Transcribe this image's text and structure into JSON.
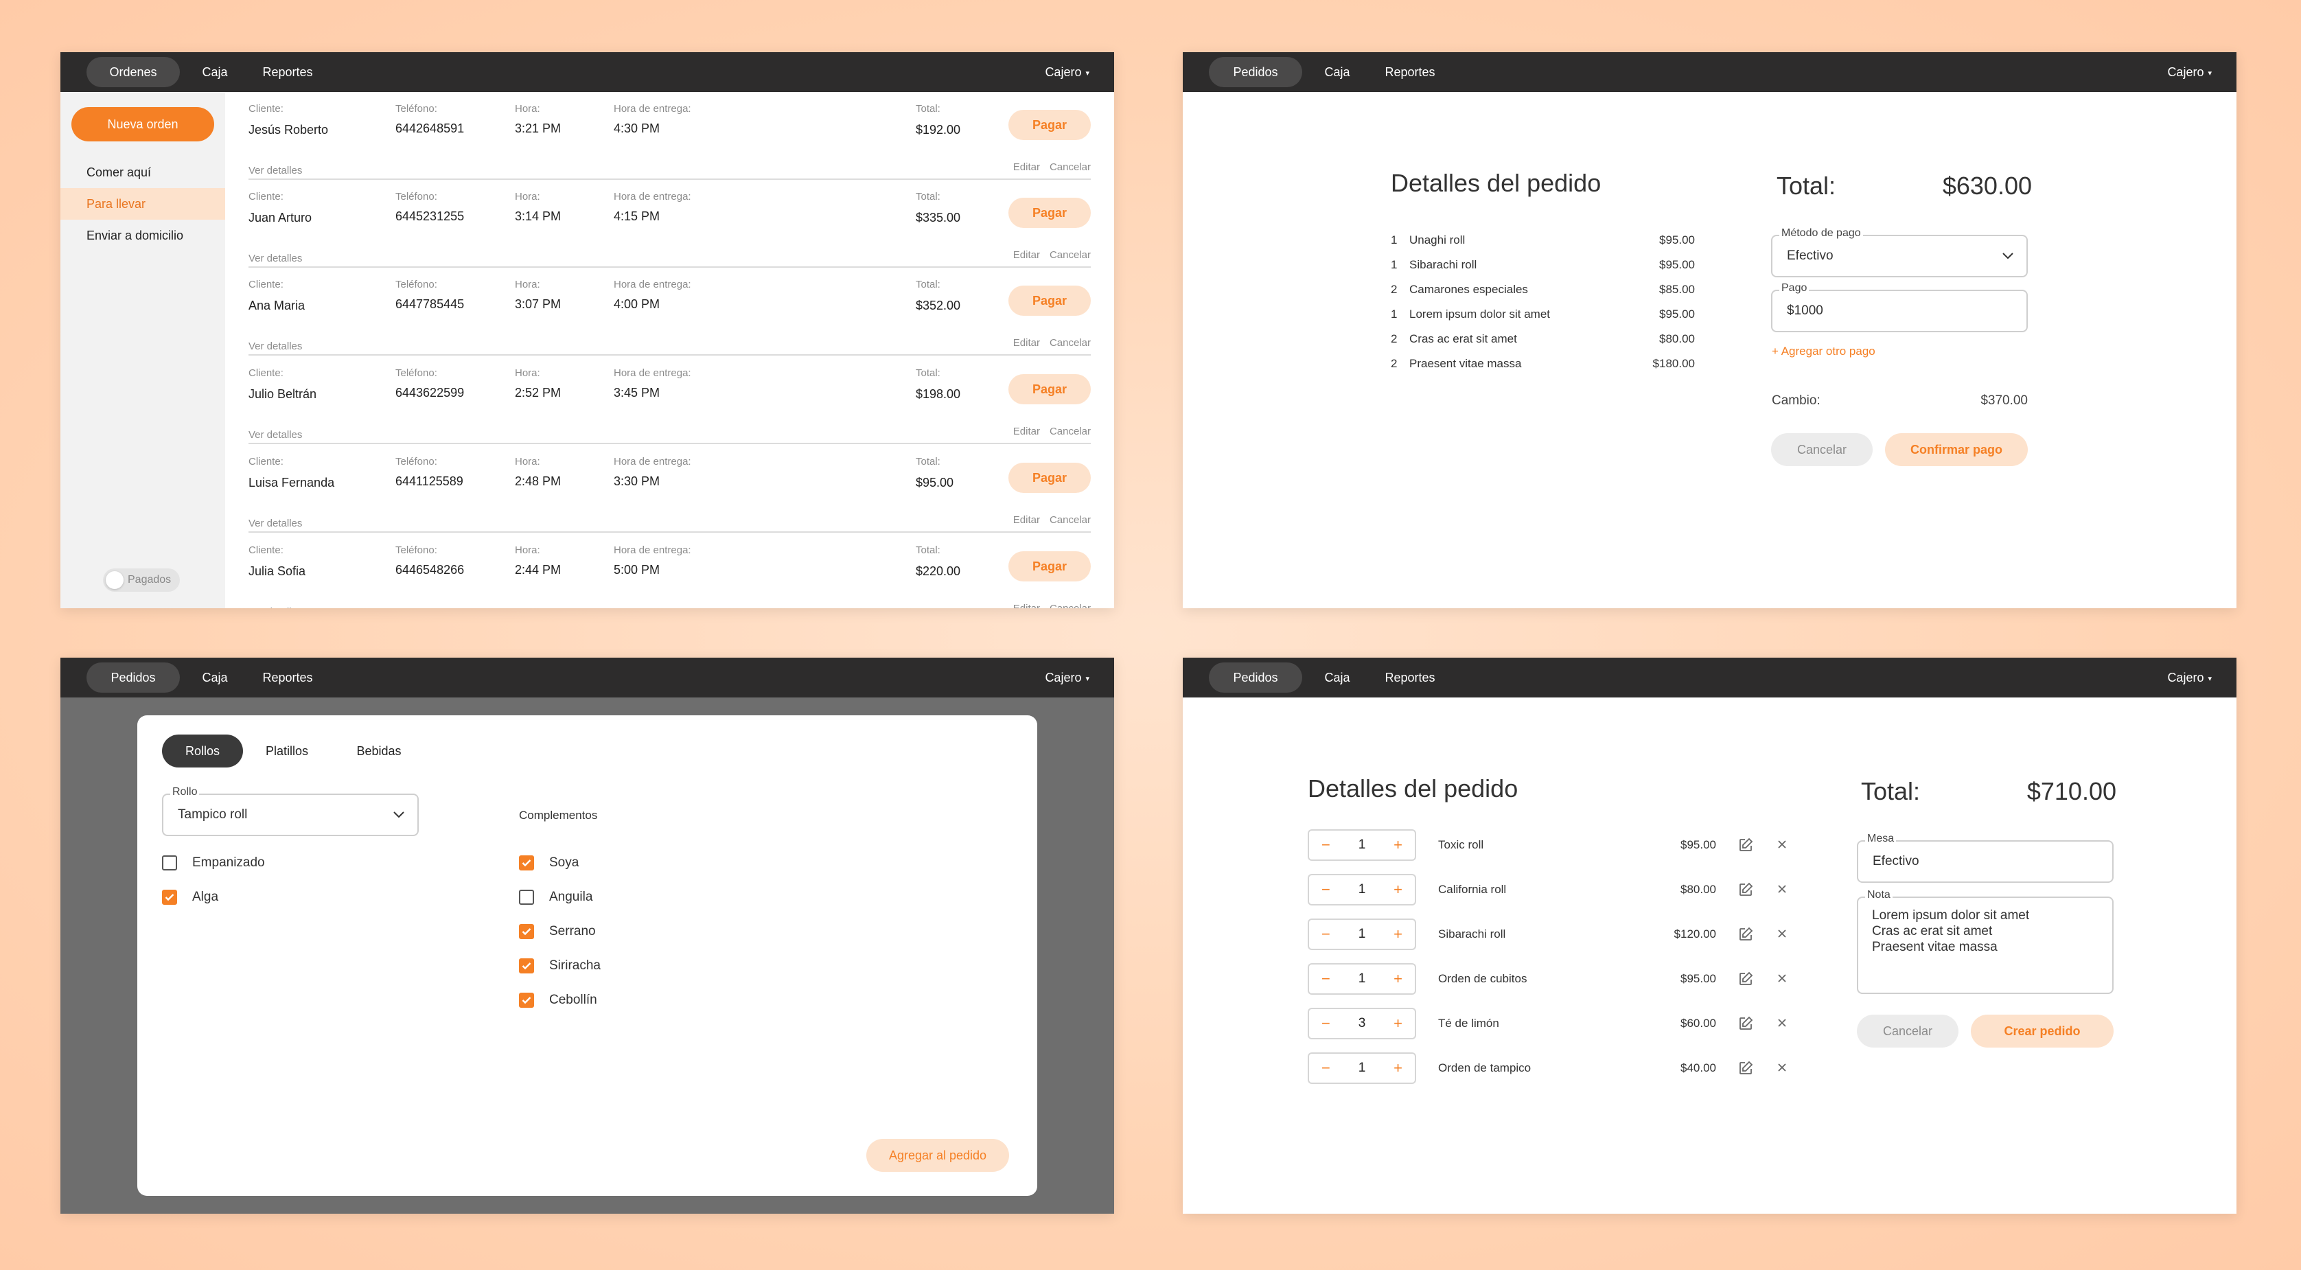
{
  "colors": {
    "accent": "#f58025",
    "accent_soft": "#fde2cc",
    "topbar": "#2d2c2c"
  },
  "panel1": {
    "nav": {
      "tabs": [
        "Ordenes",
        "Caja",
        "Reportes"
      ],
      "user": "Cajero"
    },
    "new_order": "Nueva orden",
    "sidebar": [
      "Comer aquí",
      "Para llevar",
      "Enviar a domicilio"
    ],
    "toggle": "Pagados",
    "labels": {
      "client": "Cliente:",
      "phone": "Teléfono:",
      "time": "Hora:",
      "delivery": "Hora de entrega:",
      "total": "Total:",
      "pay": "Pagar",
      "details": "Ver detalles",
      "edit": "Editar",
      "cancel": "Cancelar"
    },
    "orders": [
      {
        "client": "Jesús Roberto",
        "phone": "6442648591",
        "time": "3:21 PM",
        "delivery": "4:30 PM",
        "total": "$192.00"
      },
      {
        "client": "Juan Arturo",
        "phone": "6445231255",
        "time": "3:14 PM",
        "delivery": "4:15 PM",
        "total": "$335.00"
      },
      {
        "client": "Ana Maria",
        "phone": "6447785445",
        "time": "3:07 PM",
        "delivery": "4:00 PM",
        "total": "$352.00"
      },
      {
        "client": "Julio Beltrán",
        "phone": "6443622599",
        "time": "2:52 PM",
        "delivery": "3:45 PM",
        "total": "$198.00"
      },
      {
        "client": "Luisa Fernanda",
        "phone": "6441125589",
        "time": "2:48 PM",
        "delivery": "3:30 PM",
        "total": "$95.00"
      },
      {
        "client": "Julia Sofia",
        "phone": "6446548266",
        "time": "2:44 PM",
        "delivery": "5:00 PM",
        "total": "$220.00"
      }
    ]
  },
  "panel2": {
    "nav": {
      "tabs": [
        "Pedidos",
        "Caja",
        "Reportes"
      ],
      "user": "Cajero"
    },
    "title": "Detalles del pedido",
    "items": [
      {
        "qty": "1",
        "name": "Unaghi roll",
        "price": "$95.00"
      },
      {
        "qty": "1",
        "name": "Sibarachi roll",
        "price": "$95.00"
      },
      {
        "qty": "2",
        "name": "Camarones especiales",
        "price": "$85.00"
      },
      {
        "qty": "1",
        "name": "Lorem ipsum dolor sit amet",
        "price": "$95.00"
      },
      {
        "qty": "2",
        "name": "Cras ac erat sit amet",
        "price": "$80.00"
      },
      {
        "qty": "2",
        "name": "Praesent vitae massa",
        "price": "$180.00"
      }
    ],
    "total_label": "Total:",
    "total": "$630.00",
    "method_label": "Método de pago",
    "method": "Efectivo",
    "payment_label": "Pago",
    "payment": "$1000",
    "add_payment": "+ Agregar otro pago",
    "change_label": "Cambio:",
    "change": "$370.00",
    "cancel": "Cancelar",
    "confirm": "Confirmar pago"
  },
  "panel3": {
    "nav": {
      "tabs": [
        "Pedidos",
        "Caja",
        "Reportes"
      ],
      "user": "Cajero"
    },
    "categories": [
      "Rollos",
      "Platillos",
      "Bebidas"
    ],
    "roll_label": "Rollo",
    "roll": "Tampico roll",
    "options": [
      {
        "label": "Empanizado",
        "checked": false
      },
      {
        "label": "Alga",
        "checked": true
      }
    ],
    "complements_title": "Complementos",
    "complements": [
      {
        "label": "Soya",
        "checked": true
      },
      {
        "label": "Anguila",
        "checked": false
      },
      {
        "label": "Serrano",
        "checked": true
      },
      {
        "label": "Siriracha",
        "checked": true
      },
      {
        "label": "Cebollín",
        "checked": true
      }
    ],
    "add": "Agregar al pedido"
  },
  "panel4": {
    "nav": {
      "tabs": [
        "Pedidos",
        "Caja",
        "Reportes"
      ],
      "user": "Cajero"
    },
    "title": "Detalles del pedido",
    "items": [
      {
        "qty": "1",
        "name": "Toxic roll",
        "price": "$95.00"
      },
      {
        "qty": "1",
        "name": "California roll",
        "price": "$80.00"
      },
      {
        "qty": "1",
        "name": "Sibarachi roll",
        "price": "$120.00"
      },
      {
        "qty": "1",
        "name": "Orden de cubitos",
        "price": "$95.00"
      },
      {
        "qty": "3",
        "name": "Té de limón",
        "price": "$60.00"
      },
      {
        "qty": "1",
        "name": "Orden de tampico",
        "price": "$40.00"
      }
    ],
    "total_label": "Total:",
    "total": "$710.00",
    "table_label": "Mesa",
    "table": "Efectivo",
    "note_label": "Nota",
    "note": [
      "Lorem ipsum dolor sit amet",
      "Cras ac erat sit amet",
      "Praesent vitae massa"
    ],
    "cancel": "Cancelar",
    "create": "Crear pedido"
  }
}
